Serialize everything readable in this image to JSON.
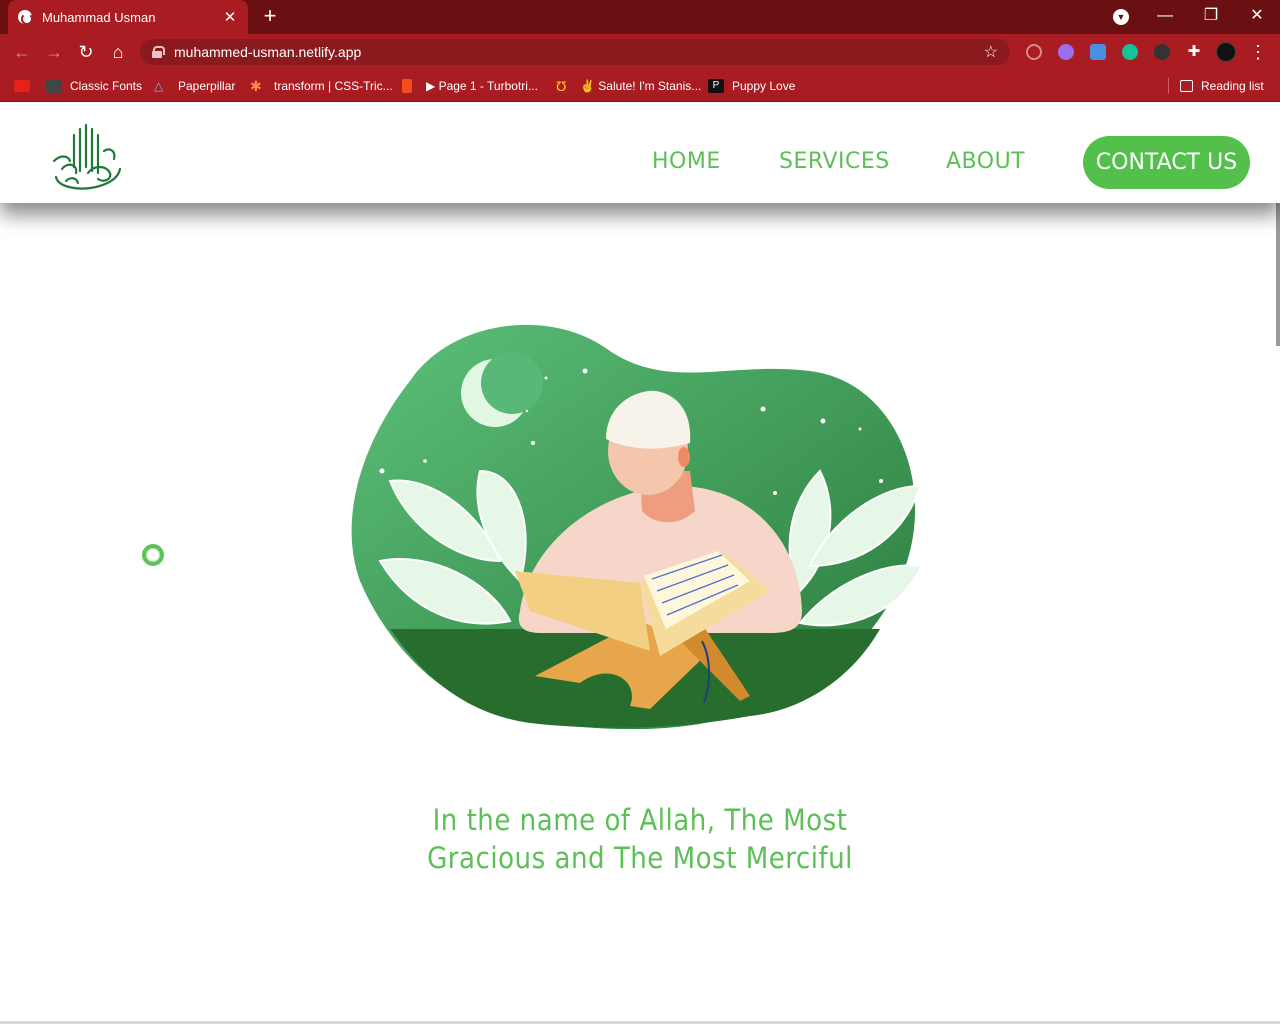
{
  "browser": {
    "tab_title": "Muhammad Usman",
    "new_tab_symbol": "+",
    "url": "muhammed-usman.netlify.app",
    "window_controls": {
      "minimize": "—",
      "restore": "❐",
      "close": "✕"
    },
    "bookmarks": [
      {
        "label": "",
        "icon": "youtube-icon"
      },
      {
        "label": "Classic Fonts",
        "icon": "sg-icon"
      },
      {
        "label": "Paperpillar",
        "icon": "paperpillar-icon"
      },
      {
        "label": "transform | CSS-Tric...",
        "icon": "css-tricks-icon"
      },
      {
        "label": "",
        "icon": "figma-icon"
      },
      {
        "label": "▶ Page 1 - Turbotri...",
        "icon": ""
      },
      {
        "label": "✌ Salute! I'm Stanis...",
        "icon": "horseshoe-icon"
      },
      {
        "label": "Puppy Love",
        "icon": "puppy-love-icon"
      }
    ],
    "reading_list": "Reading list"
  },
  "site": {
    "nav": {
      "home": "HOME",
      "services": "SERVICES",
      "about": "ABOUT",
      "contact": "CONTACT US"
    },
    "hero_text": "In the name of Allah, The Most Gracious and The Most Merciful"
  },
  "colors": {
    "chrome_dark": "#6b1012",
    "chrome": "#a81c22",
    "accent_green": "#5cbf58",
    "button_green": "#52c04b"
  }
}
